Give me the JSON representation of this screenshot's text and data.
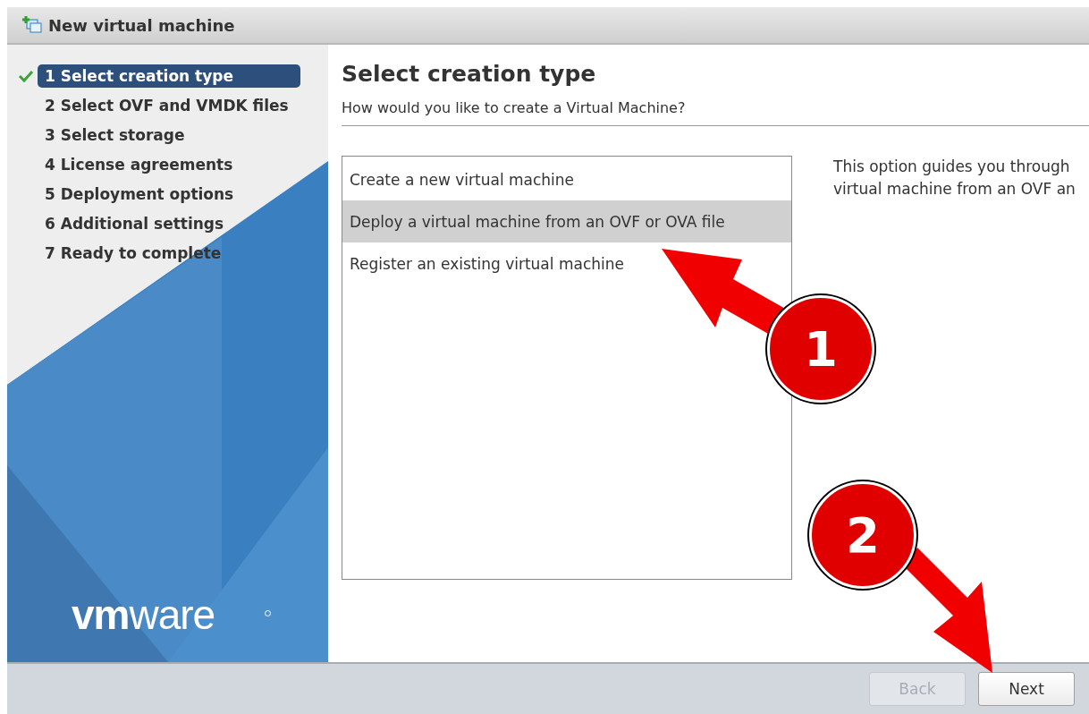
{
  "window": {
    "title": "New virtual machine"
  },
  "steps": [
    {
      "label": "1 Select creation type",
      "selected": true,
      "done": true
    },
    {
      "label": "2 Select OVF and VMDK files",
      "selected": false,
      "done": false
    },
    {
      "label": "3 Select storage",
      "selected": false,
      "done": false
    },
    {
      "label": "4 License agreements",
      "selected": false,
      "done": false
    },
    {
      "label": "5 Deployment options",
      "selected": false,
      "done": false
    },
    {
      "label": "6 Additional settings",
      "selected": false,
      "done": false
    },
    {
      "label": "7 Ready to complete",
      "selected": false,
      "done": false
    }
  ],
  "logo": "**vm**ware",
  "content": {
    "heading": "Select creation type",
    "subheading": "How would you like to create a Virtual Machine?",
    "options": [
      {
        "label": "Create a new virtual machine",
        "selected": false
      },
      {
        "label": "Deploy a virtual machine from an OVF or OVA file",
        "selected": true
      },
      {
        "label": "Register an existing virtual machine",
        "selected": false
      }
    ],
    "description_lines": [
      "This option guides you through",
      "virtual machine from an OVF an"
    ]
  },
  "buttons": [
    {
      "label": "Back",
      "disabled": true
    },
    {
      "label": "Next",
      "disabled": false
    }
  ],
  "annotations": [
    {
      "label": "1"
    },
    {
      "label": "2"
    }
  ]
}
